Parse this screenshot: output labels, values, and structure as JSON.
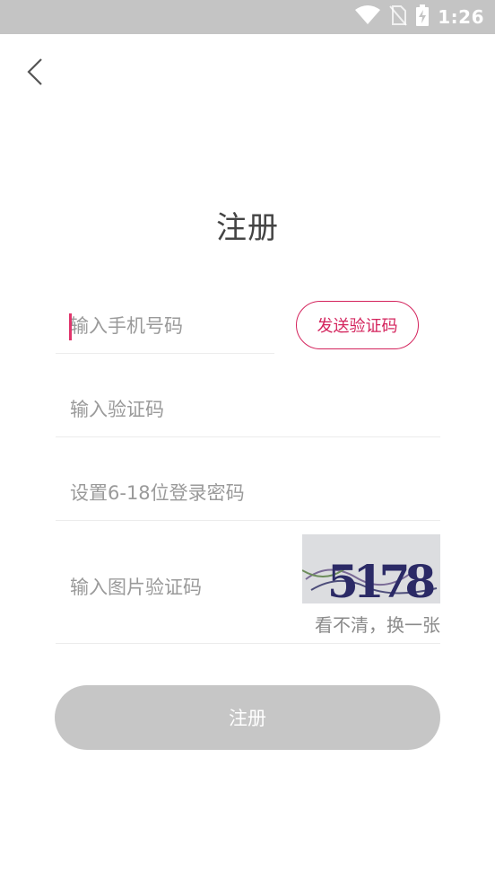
{
  "status_bar": {
    "time": "1:26",
    "icons": [
      "wifi-icon",
      "no-sim-icon",
      "battery-charging-icon"
    ],
    "background_color": "#c4c4c4"
  },
  "header": {
    "back_icon": "chevron-left-icon",
    "title": "注册"
  },
  "form": {
    "phone_placeholder": "输入手机号码",
    "send_code_label": "发送验证码",
    "code_placeholder": "输入验证码",
    "password_placeholder": "设置6-18位登录密码",
    "captcha_placeholder": "输入图片验证码",
    "captcha_text": "5178",
    "captcha_refresh_label": "看不清，换一张"
  },
  "actions": {
    "register_label": "注册"
  },
  "colors": {
    "accent": "#d4245d",
    "button_disabled": "#c6c6c6",
    "placeholder": "#9a9a9a"
  }
}
